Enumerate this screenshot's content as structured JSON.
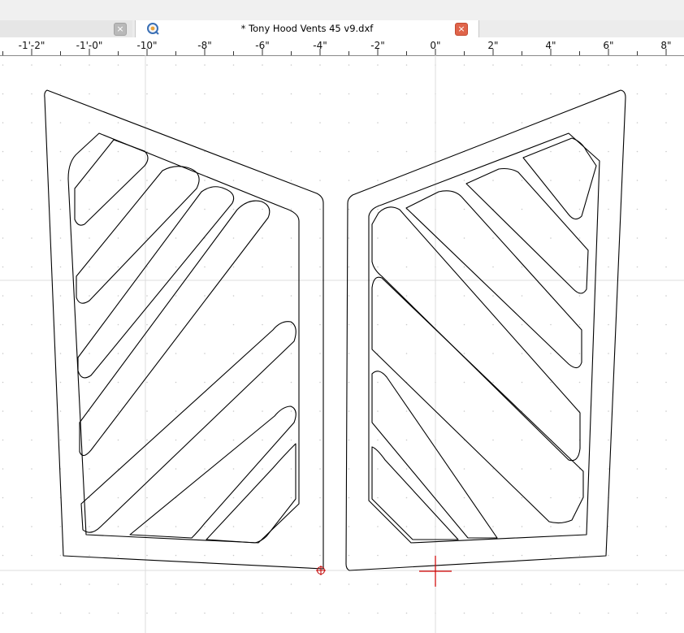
{
  "window": {
    "close_glyph": "×"
  },
  "tabs": [
    {
      "label": "",
      "active": false
    },
    {
      "label": "* Tony Hood Vents 45 v9.dxf",
      "active": true
    }
  ],
  "ruler": {
    "unit": "inch",
    "labels": [
      "-1'-2\"",
      "-1'-0\"",
      "-10\"",
      "-8\"",
      "-6\"",
      "-4\"",
      "-2\"",
      "0\"",
      "2\"",
      "4\"",
      "6\"",
      "8\""
    ]
  },
  "colors": {
    "grid_dot": "#c8c8c8",
    "grid_line": "#dcdcdc",
    "outline": "#000000",
    "cursor": "#d00000",
    "accent_close": "#e0644a"
  }
}
